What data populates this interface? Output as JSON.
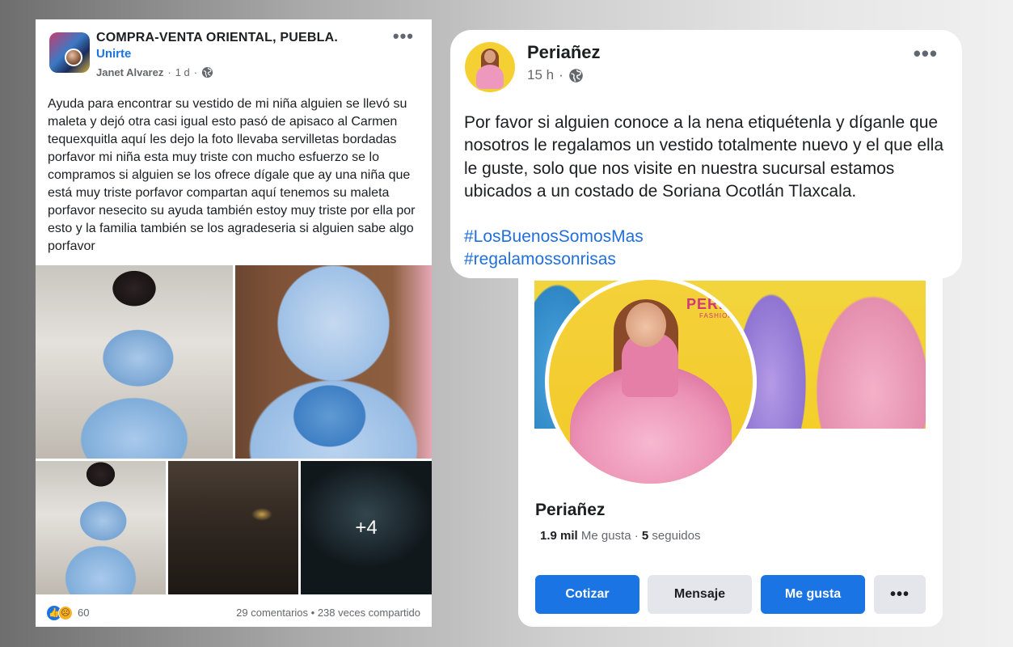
{
  "left_post": {
    "group_name": "COMPRA-VENTA ORIENTAL, PUEBLA.",
    "join_label": "Unirte",
    "author": "Janet Alvarez",
    "time": "1 d",
    "separator": "·",
    "more": "•••",
    "text": "Ayuda para encontrar su vestido de mi niña alguien se llevó su maleta y dejó otra casi igual esto pasó de apisaco al Carmen tequexquitla aquí les dejo la foto llevaba servilletas bordadas porfavor mi niña esta muy triste con mucho esfuerzo se lo compramos si alguien se  los ofrece dígale que ay una niña que está muy triste porfavor compartan aquí tenemos su maleta  porfavor nesecito su ayuda también estoy muy triste por ella por esto y la familia también se los agradeseria si alguien sabe algo porfavor",
    "more_photos": "+4",
    "reaction_count": "60",
    "comments": "29 comentarios",
    "shares": "238 veces compartido",
    "stats_separator": " • "
  },
  "right_post": {
    "page_name": "Periañez",
    "time": "15 h",
    "separator": "·",
    "more": "•••",
    "text": "Por favor si alguien conoce a la nena etiquétenla y díganle que nosotros le regalamos un vestido totalmente nuevo y el que ella le guste, solo que nos visite en nuestra sucursal estamos ubicados a un costado de Soriana Ocotlán Tlaxcala.",
    "hashtags": [
      "#LosBuenosSomosMas",
      "#regalamossonrisas"
    ]
  },
  "profile_card": {
    "name": "Periañez",
    "likes_value": "1.9 mil",
    "likes_label": " Me gusta · ",
    "following_value": "5",
    "following_label": " seguidos",
    "brand_text": "PERIA",
    "brand_sub": "FASHION",
    "buttons": {
      "cotizar": "Cotizar",
      "mensaje": "Mensaje",
      "me_gusta": "Me gusta",
      "more": "•••"
    }
  },
  "colors": {
    "facebook_blue": "#1b74e4",
    "hashtag_blue": "#216fdb",
    "text_dark": "#1c1e21",
    "text_muted": "#65676b",
    "button_gray": "#e4e6eb"
  },
  "icons": [
    "globe-icon",
    "more-icon",
    "like-reaction-icon",
    "sad-reaction-icon"
  ]
}
